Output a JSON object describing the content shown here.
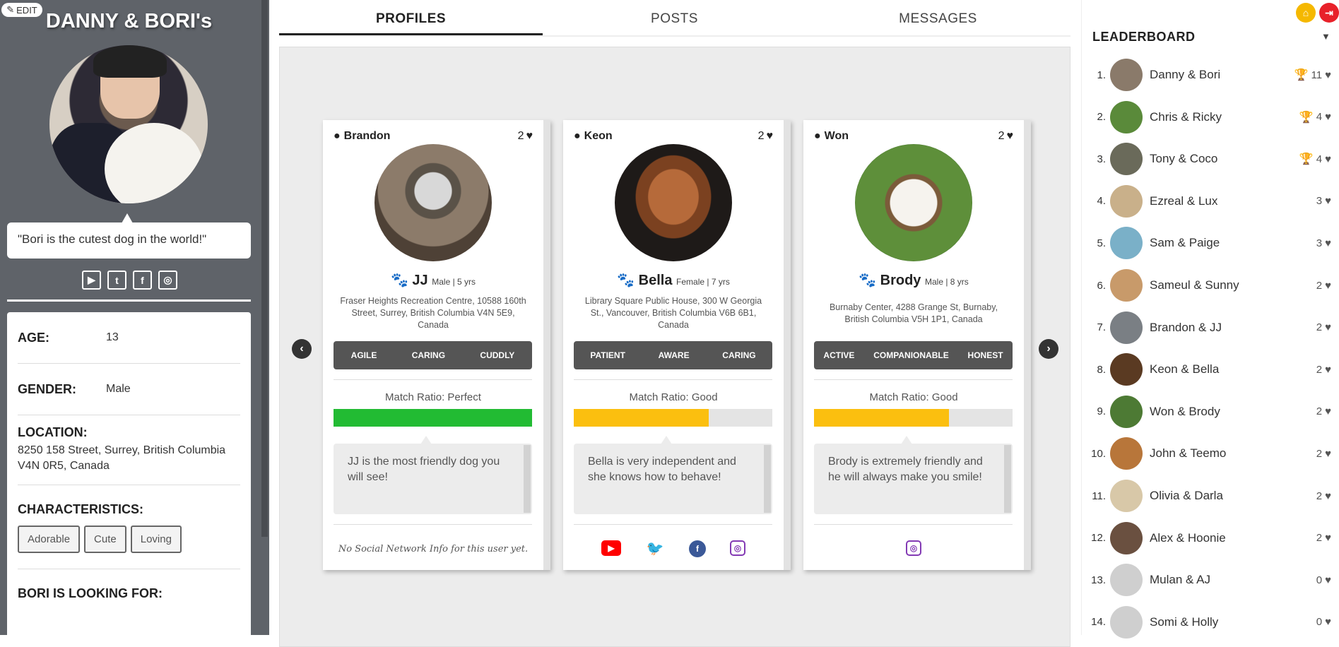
{
  "profile": {
    "edit_label": "EDIT",
    "name": "DANNY & BORI's",
    "quote": "\"Bori is the cutest dog in the world!\"",
    "socials": [
      "youtube-icon",
      "twitter-icon",
      "facebook-icon",
      "instagram-icon"
    ],
    "age_label": "AGE:",
    "age_value": "13",
    "gender_label": "GENDER:",
    "gender_value": "Male",
    "location_label": "LOCATION:",
    "location_value": "8250 158 Street, Surrey, British Columbia V4N 0R5, Canada",
    "characteristics_label": "CHARACTERISTICS:",
    "characteristics": [
      "Adorable",
      "Cute",
      "Loving"
    ],
    "looking_for_label": "BORI IS LOOKING FOR:"
  },
  "tabs": [
    "PROFILES",
    "POSTS",
    "MESSAGES"
  ],
  "cards": [
    {
      "owner": "Brandon",
      "likes": "2",
      "pet_name": "JJ",
      "pet_info": "Male | 5 yrs",
      "address": "Fraser Heights Recreation Centre, 10588 160th Street, Surrey, British Columbia V4N 5E9, Canada",
      "traits": [
        "AGILE",
        "CARING",
        "CUDDLY"
      ],
      "ratio_label": "Match Ratio: Perfect",
      "ratio": 1.0,
      "ratio_color": "#22bb33",
      "bio": "JJ is the most friendly dog you will see!",
      "no_social": "No Social Network Info for this user yet."
    },
    {
      "owner": "Keon",
      "likes": "2",
      "pet_name": "Bella",
      "pet_info": "Female | 7 yrs",
      "address": "Library Square Public House, 300 W Georgia St., Vancouver, British Columbia V6B 6B1, Canada",
      "traits": [
        "PATIENT",
        "AWARE",
        "CARING"
      ],
      "ratio_label": "Match Ratio: Good",
      "ratio": 0.68,
      "ratio_color": "#fbbf0f",
      "bio": "Bella is very independent and she knows how to behave!"
    },
    {
      "owner": "Won",
      "likes": "2",
      "pet_name": "Brody",
      "pet_info": "Male | 8 yrs",
      "address": "Burnaby Center, 4288 Grange St, Burnaby, British Columbia V5H 1P1, Canada",
      "traits": [
        "ACTIVE",
        "COMPANIONABLE",
        "HONEST"
      ],
      "ratio_label": "Match Ratio: Good",
      "ratio": 0.68,
      "ratio_color": "#fbbf0f",
      "bio": "Brody is extremely friendly and he will always make you smile!"
    }
  ],
  "leaderboard": {
    "title": "LEADERBOARD",
    "rows": [
      {
        "rank": "1.",
        "name": "Danny & Bori",
        "score": "11",
        "trophy": "gold"
      },
      {
        "rank": "2.",
        "name": "Chris & Ricky",
        "score": "4",
        "trophy": "silver"
      },
      {
        "rank": "3.",
        "name": "Tony & Coco",
        "score": "4",
        "trophy": "bronze"
      },
      {
        "rank": "4.",
        "name": "Ezreal & Lux",
        "score": "3"
      },
      {
        "rank": "5.",
        "name": "Sam & Paige",
        "score": "3"
      },
      {
        "rank": "6.",
        "name": "Sameul & Sunny",
        "score": "2"
      },
      {
        "rank": "7.",
        "name": "Brandon & JJ",
        "score": "2"
      },
      {
        "rank": "8.",
        "name": "Keon & Bella",
        "score": "2"
      },
      {
        "rank": "9.",
        "name": "Won & Brody",
        "score": "2"
      },
      {
        "rank": "10.",
        "name": "John & Teemo",
        "score": "2"
      },
      {
        "rank": "11.",
        "name": "Olivia & Darla",
        "score": "2"
      },
      {
        "rank": "12.",
        "name": "Alex & Hoonie",
        "score": "2"
      },
      {
        "rank": "13.",
        "name": "Mulan & AJ",
        "score": "0"
      },
      {
        "rank": "14.",
        "name": "Somi & Holly",
        "score": "0"
      }
    ]
  },
  "colors": {
    "sidebar": "#5f6369",
    "home_button": "#f5b800",
    "logout_button": "#e8212a",
    "youtube": "#ff0000",
    "twitter": "#1da1f2",
    "facebook": "#3b5998",
    "instagram": "#833ab4"
  }
}
